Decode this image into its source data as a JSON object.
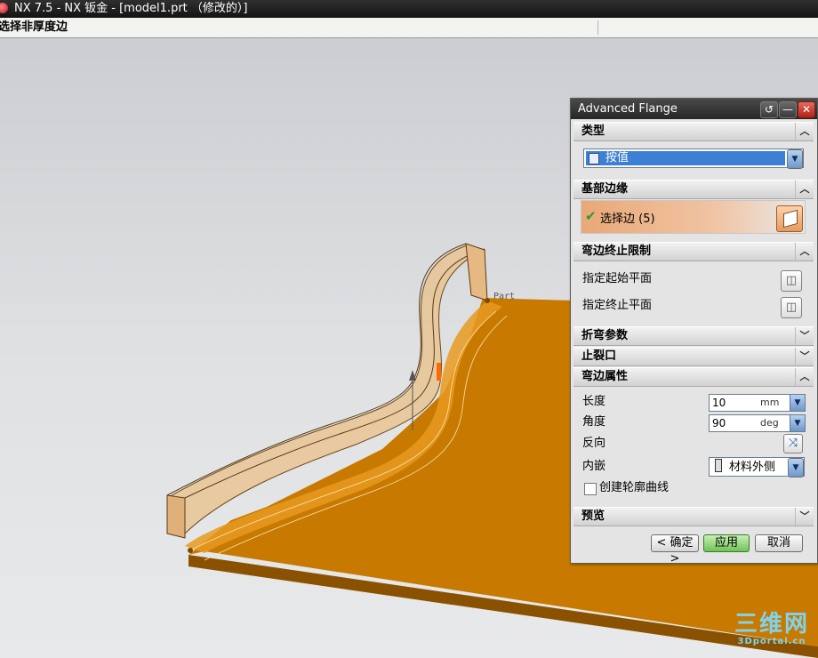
{
  "window": {
    "title": "NX 7.5 - NX 钣金 - [model1.prt （修改的）]"
  },
  "status": {
    "prompt": "选择非厚度边"
  },
  "viewport": {
    "part_label": "Part"
  },
  "dialog": {
    "title": "Advanced Flange",
    "title_buttons": {
      "reset": "↺",
      "minimize": "—",
      "close": "✕"
    },
    "sections": {
      "type": {
        "label": "类型",
        "value": "按值",
        "state": "expanded"
      },
      "base_edge": {
        "label": "基部边缘",
        "selection": "选择边 (5)",
        "state": "expanded"
      },
      "flange_limit": {
        "label": "弯边终止限制",
        "start_plane": "指定起始平面",
        "end_plane": "指定终止平面",
        "state": "expanded"
      },
      "bend_params": {
        "label": "折弯参数",
        "state": "collapsed"
      },
      "relief": {
        "label": "止裂口",
        "state": "collapsed"
      },
      "flange_props": {
        "label": "弯边属性",
        "state": "expanded",
        "length": {
          "label": "长度",
          "value": "10",
          "unit": "mm"
        },
        "angle": {
          "label": "角度",
          "value": "90",
          "unit": "deg"
        },
        "reverse": {
          "label": "反向"
        },
        "inset": {
          "label": "内嵌",
          "value": "材料外侧"
        },
        "profile_checkbox": {
          "label": "创建轮廓曲线",
          "checked": false
        }
      },
      "preview": {
        "label": "预览",
        "state": "collapsed"
      }
    },
    "buttons": {
      "ok": "< 确定 >",
      "apply": "应用",
      "cancel": "取消"
    }
  },
  "watermark": {
    "line1": "三维网",
    "line2": "3Dportal.cn"
  },
  "colors": {
    "sheet_metal": "#c87a00",
    "flange_translucent": "#e8b873",
    "selection_accent": "#3d7fd4"
  }
}
